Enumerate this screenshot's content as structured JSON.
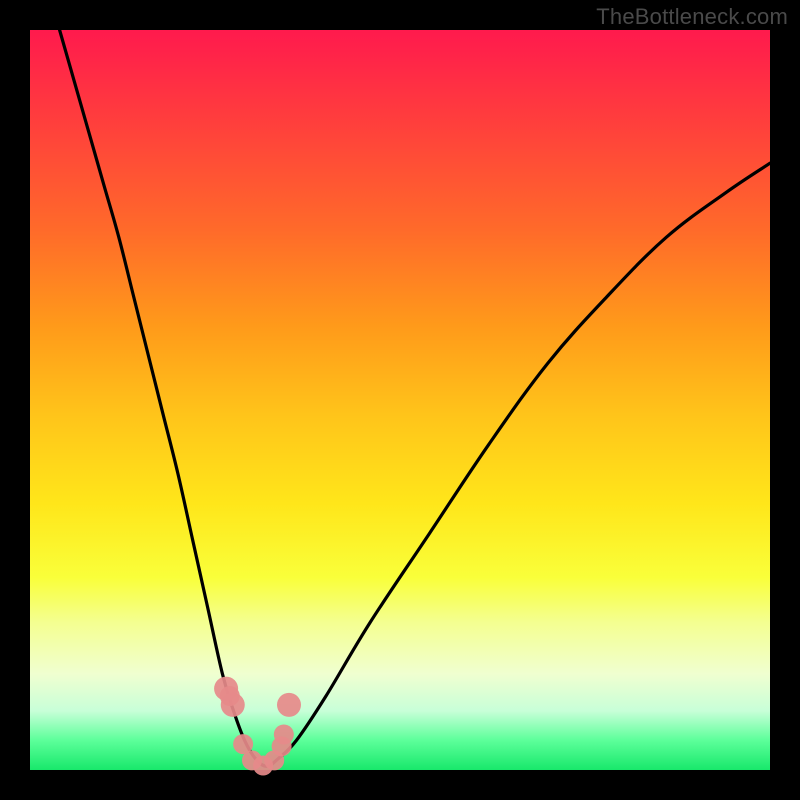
{
  "watermark": "TheBottleneck.com",
  "chart_data": {
    "type": "line",
    "title": "",
    "xlabel": "",
    "ylabel": "",
    "xlim": [
      0,
      100
    ],
    "ylim": [
      0,
      100
    ],
    "series": [
      {
        "name": "bottleneck-curve",
        "x": [
          4,
          6,
          8,
          10,
          12,
          14,
          16,
          18,
          20,
          22,
          24,
          26,
          27.5,
          29,
          30.5,
          32,
          33.5,
          36,
          40,
          46,
          54,
          62,
          70,
          78,
          86,
          94,
          100
        ],
        "y": [
          100,
          93,
          86,
          79,
          72,
          64,
          56,
          48,
          40,
          31,
          22,
          13,
          8,
          4,
          1.5,
          0.5,
          1.5,
          4,
          10,
          20,
          32,
          44,
          55,
          64,
          72,
          78,
          82
        ]
      }
    ],
    "markers": {
      "name": "highlight-points",
      "x": [
        26.5,
        27.0,
        27.4,
        28.8,
        30.0,
        31.5,
        33.0,
        34.0,
        34.3,
        35.0
      ],
      "y": [
        11.0,
        10.0,
        8.8,
        3.5,
        1.3,
        0.6,
        1.3,
        3.2,
        4.8,
        8.8
      ],
      "r": [
        12,
        10,
        12,
        10,
        10,
        10,
        10,
        10,
        10,
        12
      ]
    },
    "note": "Axes have no visible tick labels in the source image; x/y are expressed in percent of plot width/height. y = estimated bottleneck percentage. Curve minimum is near x ≈ 32."
  }
}
